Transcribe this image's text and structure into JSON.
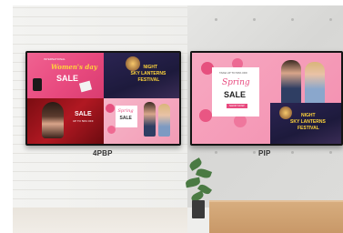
{
  "captions": {
    "left": "4PBP",
    "right": "PIP"
  },
  "content": {
    "q1_small": "INTERNATIONAL",
    "q1_script": "Women's day",
    "q1_sale": "SALE",
    "q2_line1": "NIGHT",
    "q2_line2": "SKY LANTERNS",
    "q2_line3": "FESTIVAL",
    "q3_sale": "SALE",
    "q3_small": "UP TO 50% OFF",
    "q4_script": "Spring",
    "q4_sale": "SALE",
    "pip_small": "TAKE UP TO 50% OFF",
    "pip_script": "Spring",
    "pip_sale": "SALE",
    "pip_button": "SHOP NOW",
    "pip_inset_line1": "NIGHT",
    "pip_inset_line2": "SKY LANTERNS",
    "pip_inset_line3": "FESTIVAL"
  },
  "colors": {
    "pink": "#f06291",
    "navy": "#1d1a3c",
    "red": "#b11822",
    "yellow": "#ffd43b"
  }
}
